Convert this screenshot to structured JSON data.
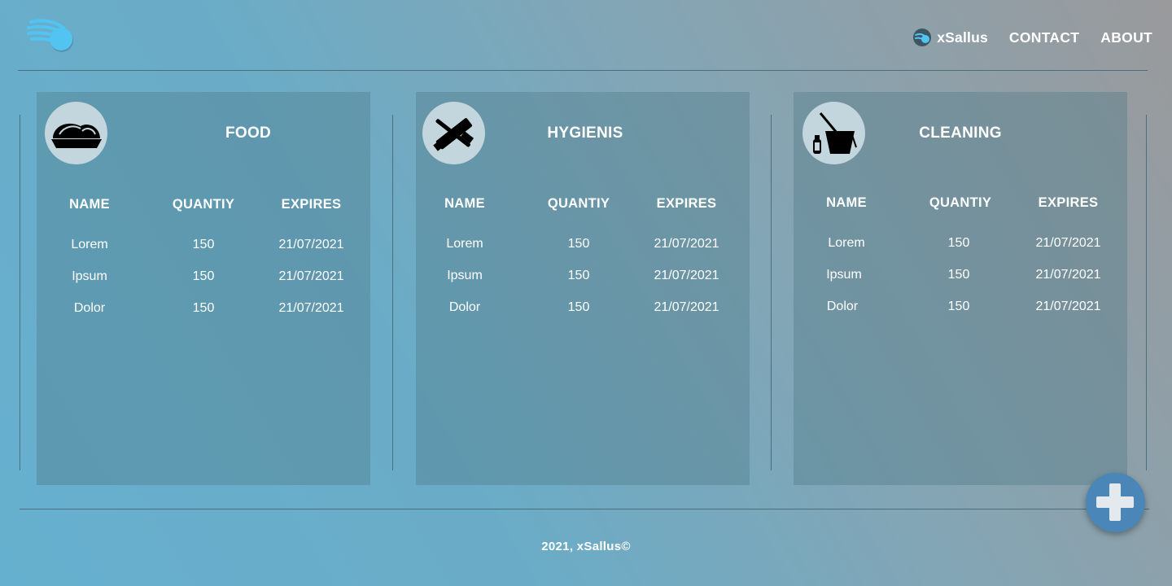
{
  "header": {
    "logo_icon": "speed-ball-logo-icon",
    "brand_icon": "speed-ball-icon",
    "brand": "xSallus",
    "nav": [
      "CONTACT",
      "ABOUT"
    ]
  },
  "columns": {
    "name": "NAME",
    "quantity": "QUANTIY",
    "expires": "EXPIRES"
  },
  "categories": [
    {
      "title": "FOOD",
      "icon": "food-dish-icon",
      "rows": [
        {
          "name": "Lorem",
          "quantity": "150",
          "expires": "21/07/2021"
        },
        {
          "name": "Ipsum",
          "quantity": "150",
          "expires": "21/07/2021"
        },
        {
          "name": "Dolor",
          "quantity": "150",
          "expires": "21/07/2021"
        }
      ]
    },
    {
      "title": "HYGIENIS",
      "icon": "toothbrush-toothpaste-icon",
      "rows": [
        {
          "name": "Lorem",
          "quantity": "150",
          "expires": "21/07/2021"
        },
        {
          "name": "Ipsum",
          "quantity": "150",
          "expires": "21/07/2021"
        },
        {
          "name": "Dolor",
          "quantity": "150",
          "expires": "21/07/2021"
        }
      ]
    },
    {
      "title": "CLEANING",
      "icon": "bucket-mop-bottle-icon",
      "rows": [
        {
          "name": "Lorem",
          "quantity": "150",
          "expires": "21/07/2021"
        },
        {
          "name": "Ipsum",
          "quantity": "150",
          "expires": "21/07/2021"
        },
        {
          "name": "Dolor",
          "quantity": "150",
          "expires": "21/07/2021"
        }
      ]
    }
  ],
  "fab": {
    "icon": "plus-icon"
  },
  "footer": {
    "text": "2021, xSallus©"
  },
  "colors": {
    "logo": "#4fc3f7",
    "panel": "#5f8b9b",
    "icon_circle": "#c4d6dd",
    "fab": "#4a86b8",
    "divider": "#4d6e7c"
  }
}
